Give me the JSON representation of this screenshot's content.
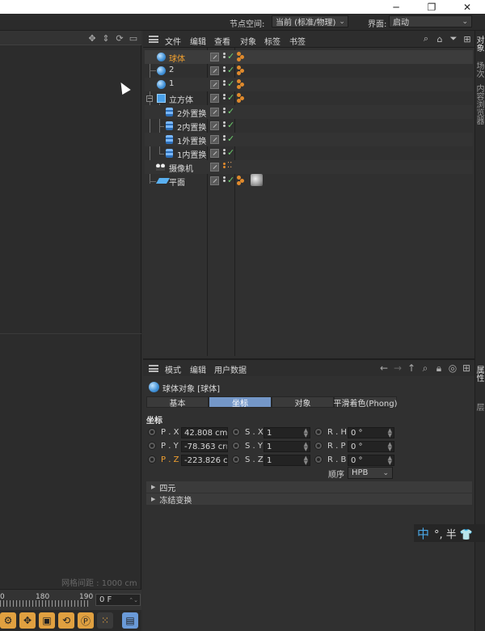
{
  "window": {
    "minimize": "─",
    "restore": "❐",
    "close": "✕"
  },
  "topbar": {
    "node_space_label": "节点空间:",
    "node_space_value": "当前 (标准/物理)",
    "interface_label": "界面:",
    "interface_value": "启动"
  },
  "object_manager": {
    "menu": [
      "文件",
      "编辑",
      "查看",
      "对象",
      "标签",
      "书签"
    ],
    "objects": [
      {
        "name": "球体",
        "icon": "sphere-icon",
        "highlight": true
      },
      {
        "name": "2",
        "icon": "sphere-icon"
      },
      {
        "name": "1",
        "icon": "sphere-icon"
      },
      {
        "name": "立方体",
        "icon": "cube-icon"
      },
      {
        "name": "2外置换",
        "icon": "instance-icon"
      },
      {
        "name": "2内置换",
        "icon": "instance-icon"
      },
      {
        "name": "1外置换",
        "icon": "instance-icon"
      },
      {
        "name": "1内置换",
        "icon": "instance-icon"
      },
      {
        "name": "摄像机",
        "icon": "camera-icon"
      },
      {
        "name": "平面",
        "icon": "plane-icon"
      }
    ]
  },
  "side_tabs": [
    "对象",
    "场次",
    "内容浏览器",
    "属性",
    "层"
  ],
  "attribute_manager": {
    "menu": [
      "模式",
      "编辑",
      "用户数据"
    ],
    "title": "球体对象 [球体]",
    "tabs": [
      "基本",
      "坐标",
      "对象",
      "平滑着色(Phong)"
    ],
    "active_tab": "坐标",
    "section": "坐标",
    "rows": [
      {
        "p_label": "P . X",
        "p_value": "42.808 cm",
        "s_label": "S . X",
        "s_value": "1",
        "r_label": "R . H",
        "r_value": "0 °"
      },
      {
        "p_label": "P . Y",
        "p_value": "-78.363 cr",
        "s_label": "S . Y",
        "s_value": "1",
        "r_label": "R . P",
        "r_value": "0 °"
      },
      {
        "p_label": "P . Z",
        "p_value": "-223.826 c",
        "s_label": "S . Z",
        "s_value": "1",
        "r_label": "R . B",
        "r_value": "0 °"
      }
    ],
    "order_label": "顺序",
    "order_value": "HPB",
    "groups": [
      "四元",
      "冻结变换"
    ]
  },
  "viewport": {
    "grid_spacing": "网格间距 : 1000 cm"
  },
  "timeline": {
    "ticks": [
      "0",
      "180",
      "190"
    ],
    "frame": "0 F"
  },
  "ime": {
    "mode": "中",
    "rest": "°, 半 👕"
  },
  "accent_colors": {
    "selected_name": "#f0a030",
    "active_tab": "#7497c8",
    "check": "#6fd26f"
  }
}
